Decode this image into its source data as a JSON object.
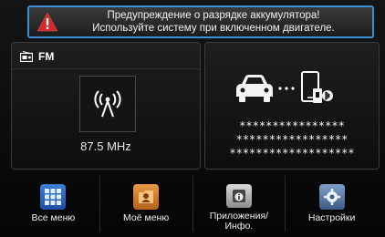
{
  "warning": {
    "line1": "Предупреждение о разрядке аккумулятора!",
    "line2": "Используйте систему при включенном двигателе."
  },
  "radio": {
    "band": "FM",
    "frequency": "87.5 MHz"
  },
  "phone": {
    "line1": "****************",
    "line2": "*****************",
    "line3": "*******************"
  },
  "menu": {
    "items": [
      {
        "label": "Все меню"
      },
      {
        "label": "Моё меню"
      },
      {
        "label": "Приложения/\nИнфо."
      },
      {
        "label": "Настройки"
      }
    ]
  }
}
